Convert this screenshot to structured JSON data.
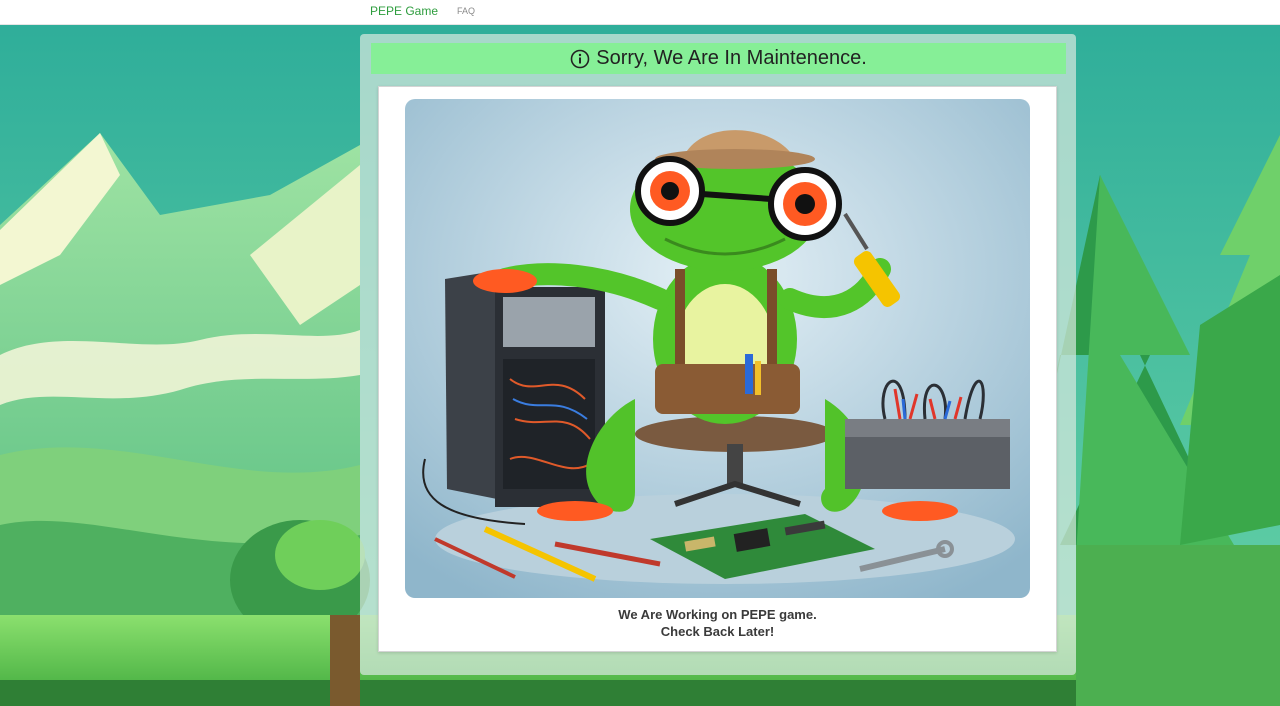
{
  "nav": {
    "brand": "PEPE Game",
    "links": [
      "FAQ"
    ]
  },
  "maintenance": {
    "icon": "info-icon",
    "title": "Sorry, We Are In Maintenence.",
    "message_line1": "We Are Working on PEPE game.",
    "message_line2": "Check Back Later!"
  },
  "colors": {
    "brand_green": "#2e9d3e",
    "header_green": "#86ef97"
  }
}
